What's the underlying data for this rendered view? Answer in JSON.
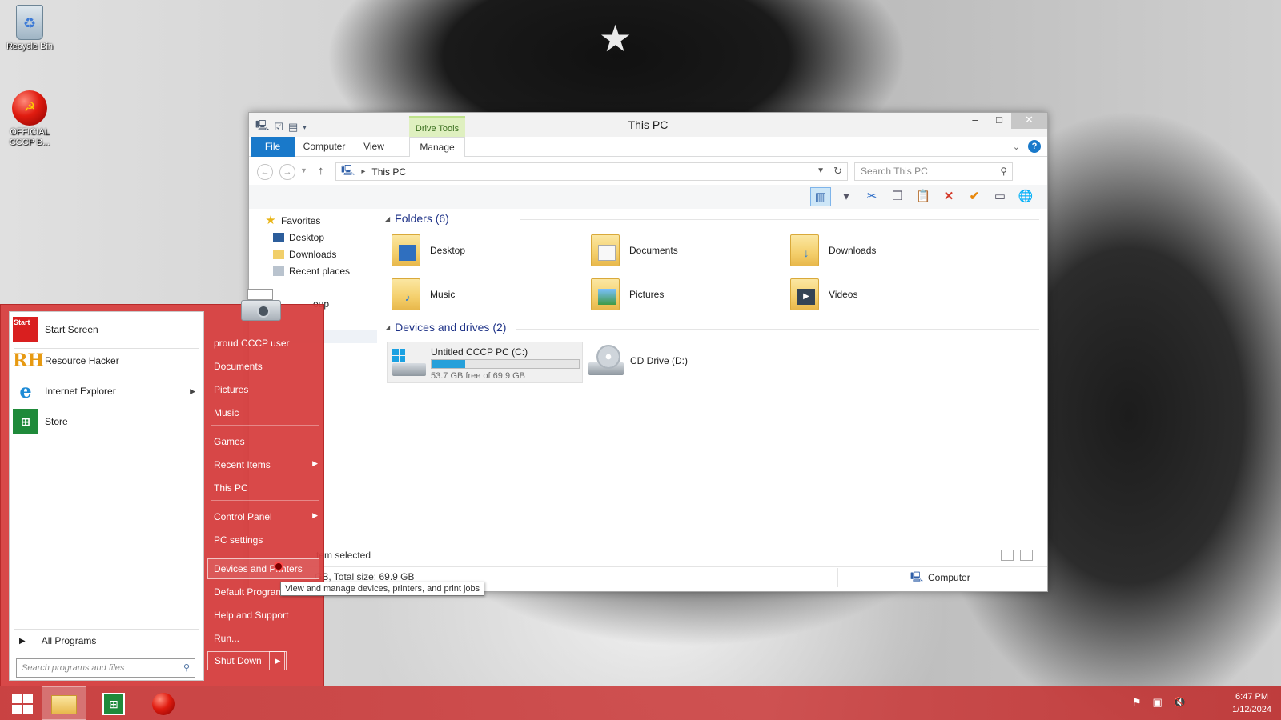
{
  "desktop": {
    "icons": [
      {
        "label": "Recycle Bin",
        "icon": "recycle-bin-icon"
      },
      {
        "label": "OFFICIAL CCCP B...",
        "icon": "cccp-shortcut-icon"
      }
    ]
  },
  "explorer": {
    "title": "This PC",
    "contextual_tab_group": "Drive Tools",
    "ribbon_tabs": [
      "File",
      "Computer",
      "View",
      "Manage"
    ],
    "address": {
      "location": "This PC"
    },
    "search": {
      "placeholder": "Search This PC"
    },
    "nav_pane": {
      "favorites": "Favorites",
      "items": [
        "Desktop",
        "Downloads",
        "Recent places"
      ],
      "partial_item": "oup"
    },
    "folders": {
      "header": "Folders (6)",
      "items": [
        "Desktop",
        "Documents",
        "Downloads",
        "Music",
        "Pictures",
        "Videos"
      ]
    },
    "devices": {
      "header": "Devices and drives (2)",
      "drive_c": {
        "name": "Untitled CCCP PC (C:)",
        "free_text": "53.7 GB free of 69.9 GB",
        "used_fraction": 0.23
      },
      "drive_d": {
        "name": "CD Drive (D:)"
      }
    },
    "status": {
      "selected": "tem selected",
      "size_info": "GB, Total size: 69.9 GB",
      "location": "Computer"
    }
  },
  "start_menu": {
    "programs": [
      "Start Screen",
      "Resource Hacker",
      "Internet Explorer",
      "Store"
    ],
    "start_icon_text": "Start",
    "all_programs": "All Programs",
    "search_placeholder": "Search programs and files",
    "links": [
      "proud CCCP user",
      "Documents",
      "Pictures",
      "Music",
      "Games",
      "Recent Items",
      "This PC",
      "Control Panel",
      "PC settings",
      "Devices and Printers",
      "Default Program",
      "Help and Support",
      "Run..."
    ],
    "shutdown": "Shut Down",
    "tooltip": "View and manage devices, printers, and print jobs",
    "highlighted": "Devices and Printers"
  },
  "taskbar": {
    "pinned": [
      "windows-start-icon",
      "file-explorer-icon",
      "store-icon",
      "cccp-app-icon"
    ],
    "clock": {
      "time": "6:47 PM",
      "date": "1/12/2024"
    }
  },
  "colors": {
    "start_menu_red": "#d73e3e",
    "ribbon_blue": "#1979ca",
    "drive_tools_green": "#dff0c0",
    "drive_bar": "#26a0da"
  }
}
